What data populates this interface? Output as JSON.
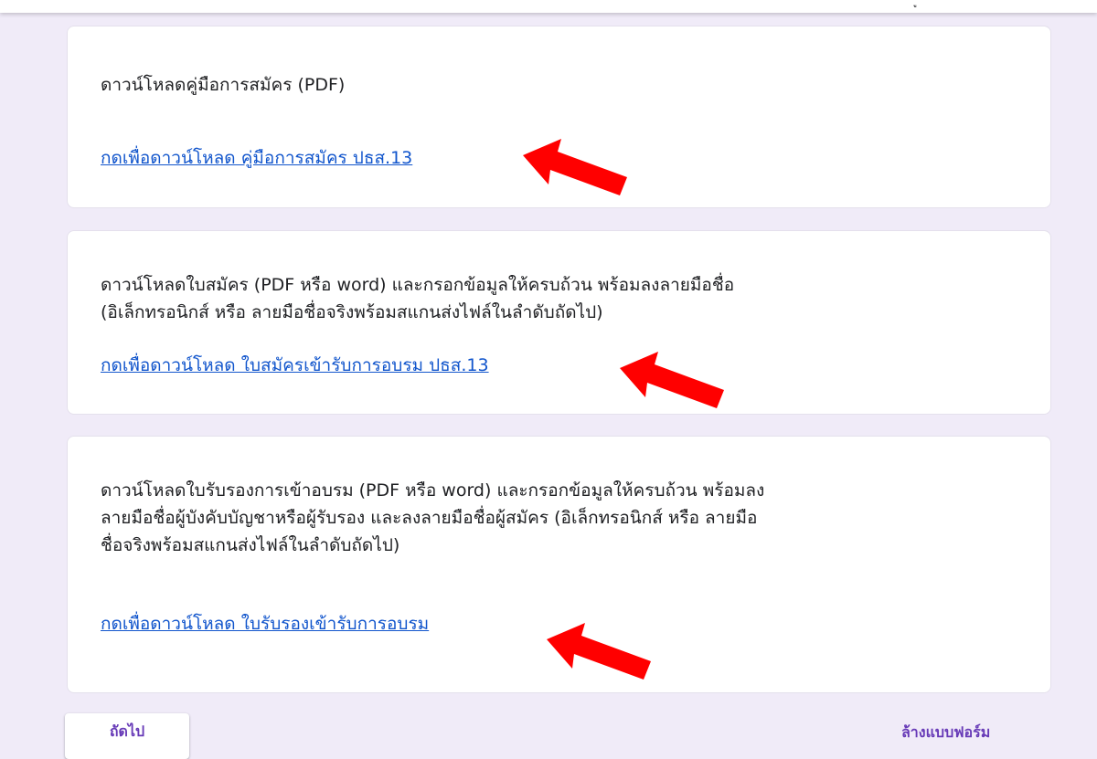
{
  "topbar": {
    "partial_text": "ู"
  },
  "sections": [
    {
      "text": "ดาวน์โหลดคู่มือการสมัคร (PDF)",
      "link": "กดเพื่อดาวน์โหลด คู่มือการสมัคร ปธส.13"
    },
    {
      "text_line1": "ดาวน์โหลดใบสมัคร (PDF หรือ word) และกรอกข้อมูลให้ครบถ้วน พร้อมลงลายมือชื่อ",
      "text_line2": "(อิเล็กทรอนิกส์ หรือ ลายมือชื่อจริงพร้อมสแกนส่งไฟล์ในลำดับถัดไป)",
      "link": "กดเพื่อดาวน์โหลด ใบสมัครเข้ารับการอบรม ปธส.13"
    },
    {
      "text_line1": "ดาวน์โหลดใบรับรองการเข้าอบรม (PDF หรือ word) และกรอกข้อมูลให้ครบถ้วน พร้อมลง",
      "text_line2": "ลายมือชื่อผู้บังคับบัญชาหรือผู้รับรอง และลงลายมือชื่อผู้สมัคร (อิเล็กทรอนิกส์ หรือ ลายมือ",
      "text_line3": "ชื่อจริงพร้อมสแกนส่งไฟล์ในลำดับถัดไป)",
      "link": "กดเพื่อดาวน์โหลด ใบรับรองเข้ารับการอบรม"
    }
  ],
  "footer": {
    "next_label": "ถัดไป",
    "clear_label": "ล้างแบบฟอร์ม"
  },
  "colors": {
    "background": "#f0ebf8",
    "link": "#1155cc",
    "accent": "#673ab7",
    "arrow": "#ff0000"
  },
  "icons": {
    "annotation": "red-arrow-icon"
  }
}
